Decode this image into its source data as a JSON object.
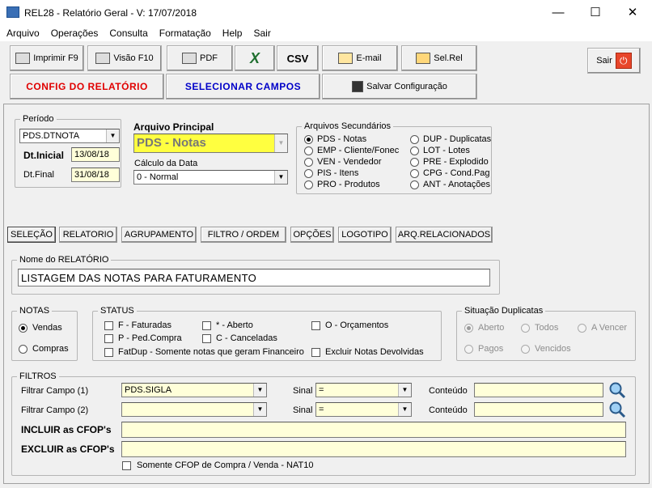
{
  "window": {
    "title": "REL28 - Relatório Geral - V: 17/07/2018",
    "minimize": "—",
    "maximize": "☐",
    "close": "✕"
  },
  "menu": [
    "Arquivo",
    "Operações",
    "Consulta",
    "Formatação",
    "Help",
    "Sair"
  ],
  "toolbar": {
    "print": "Imprimir F9",
    "preview": "Visão F10",
    "pdf": "PDF",
    "excel_icon": "X",
    "csv": "CSV",
    "email": "E-mail",
    "selrel": "Sel.Rel",
    "exit": "Sair",
    "config": "CONFIG  DO  RELATÓRIO",
    "select_fields": "SELECIONAR  CAMPOS",
    "save_config": "Salvar Configuração"
  },
  "periodo": {
    "legend": "Período",
    "field": "PDS.DTNOTA",
    "dt_inicial_label": "Dt.Inicial",
    "dt_inicial": "13/08/18",
    "dt_final_label": "Dt.Final",
    "dt_final": "31/08/18"
  },
  "arquivo_principal": {
    "label": "Arquivo Principal",
    "value": "PDS - Notas"
  },
  "calculo_data": {
    "label": "Cálculo da Data",
    "value": "0 - Normal"
  },
  "arquivos_secundarios": {
    "legend": "Arquivos Secundários",
    "col1": [
      "PDS - Notas",
      "EMP - Cliente/Fonec",
      "VEN - Vendedor",
      "PIS - Itens",
      "PRO - Produtos"
    ],
    "col2": [
      "DUP - Duplicatas",
      "LOT - Lotes",
      "PRE - Explodido",
      "CPG - Cond.Pag",
      "ANT - Anotações"
    ],
    "selected": "PDS - Notas"
  },
  "tabs": [
    "SELEÇÃO",
    "RELATORIO",
    "AGRUPAMENTO",
    "FILTRO / ORDEM",
    "OPÇÕES",
    "LOGOTIPO",
    "ARQ.RELACIONADOS"
  ],
  "nome_relatorio": {
    "legend": "Nome do RELATÓRIO",
    "value": "LISTAGEM DAS NOTAS PARA FATURAMENTO"
  },
  "notas": {
    "legend": "NOTAS",
    "options": [
      "Vendas",
      "Compras"
    ],
    "selected": "Vendas"
  },
  "status": {
    "legend": "STATUS",
    "items": [
      "F - Faturadas",
      "P - Ped.Compra",
      "FatDup - Somente notas que geram Financeiro",
      "* - Aberto",
      "C - Canceladas",
      "O - Orçamentos",
      "Excluir Notas Devolvidas"
    ]
  },
  "situacao": {
    "legend": "Situação Duplicatas",
    "options": [
      "Aberto",
      "Todos",
      "A Vencer",
      "Pagos",
      "Vencidos"
    ],
    "selected": "Aberto"
  },
  "filtros": {
    "legend": "FILTROS",
    "campo1_label": "Filtrar Campo (1)",
    "campo1": "PDS.SIGLA",
    "campo2_label": "Filtrar Campo (2)",
    "campo2": "",
    "sinal_label": "Sinal",
    "sinal1": "=",
    "sinal2": "=",
    "conteudo_label": "Conteúdo",
    "incluir_label": "INCLUIR as CFOP's",
    "excluir_label": "EXCLUIR as CFOP's",
    "somente_cfop": "Somente CFOP de  Compra / Venda - NAT10"
  }
}
